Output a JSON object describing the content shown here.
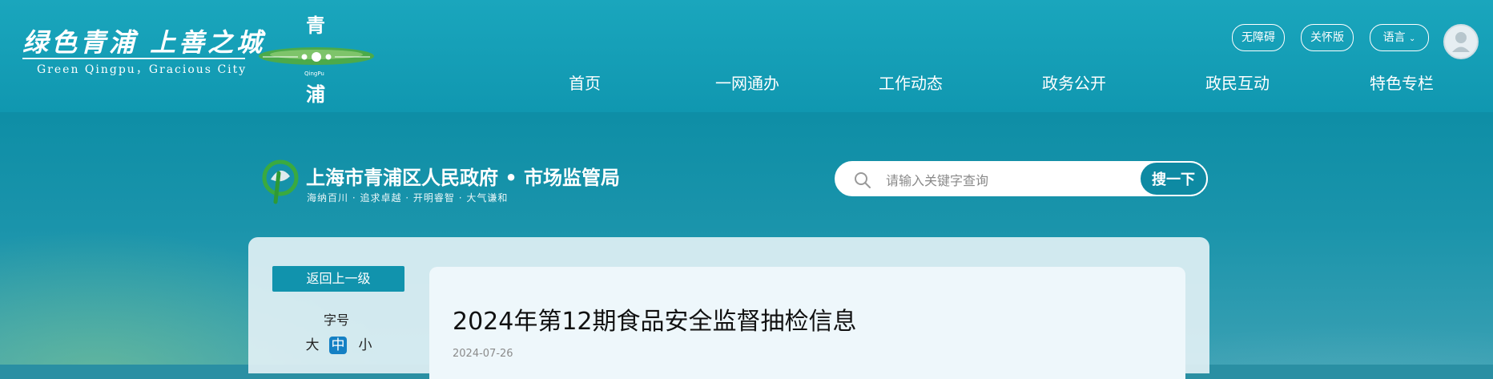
{
  "brand": {
    "slogan": "绿色青浦  上善之城",
    "slogan_en": "Green Qingpu，Gracious City",
    "emblem_top": "青",
    "emblem_pinyin": "QingPu",
    "emblem_bottom": "浦"
  },
  "toolbar": {
    "accessibility": "无障碍",
    "elderly": "关怀版",
    "language": "语言",
    "language_icon": "chevron-down-icon"
  },
  "nav": [
    "首页",
    "一网通办",
    "工作动态",
    "政务公开",
    "政民互动",
    "特色专栏"
  ],
  "site": {
    "title": "上海市青浦区人民政府 • 市场监管局",
    "tagline": "海纳百川 · 追求卓越 · 开明睿智 · 大气谦和"
  },
  "search": {
    "placeholder": "请输入关键字查询",
    "button": "搜一下"
  },
  "sidebar": {
    "back": "返回上一级",
    "font_label": "字号",
    "sizes": [
      "大",
      "中",
      "小"
    ],
    "active_size": "中"
  },
  "article": {
    "title": "2024年第12期食品安全监督抽检信息",
    "date": "2024-07-26"
  },
  "colors": {
    "header_bg": "#1097b0",
    "button_bg": "#1193ad",
    "active_size_bg": "#1480c4"
  }
}
